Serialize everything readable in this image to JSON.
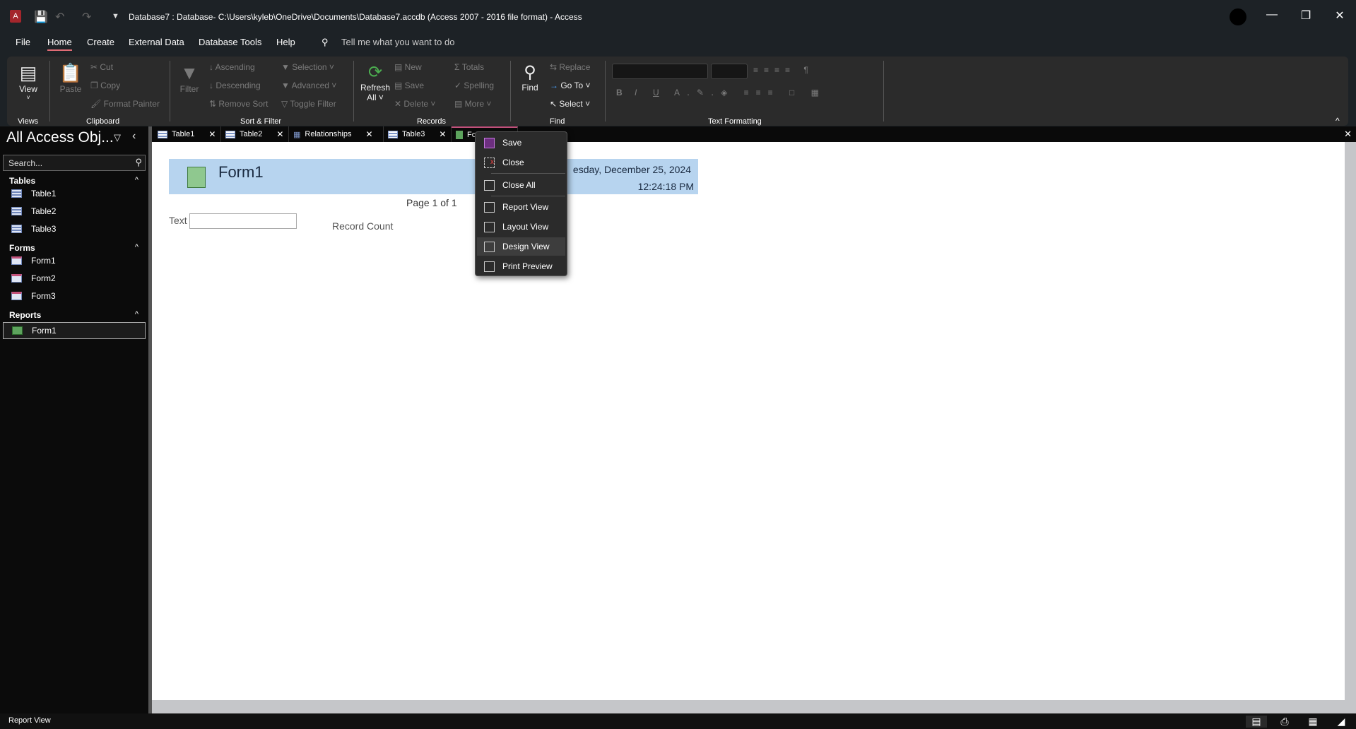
{
  "titlebar": {
    "title": "Database7 : Database- C:\\Users\\kyleb\\OneDrive\\Documents\\Database7.accdb (Access 2007 - 2016 file format)  -  Access"
  },
  "menu": {
    "items": [
      "File",
      "Home",
      "Create",
      "External Data",
      "Database Tools",
      "Help"
    ],
    "tell_me": "Tell me what you want to do"
  },
  "ribbon": {
    "views": {
      "view": "View",
      "group": "Views"
    },
    "clipboard": {
      "paste": "Paste",
      "cut": "Cut",
      "copy": "Copy",
      "format_painter": "Format Painter",
      "group": "Clipboard"
    },
    "sort_filter": {
      "filter": "Filter",
      "ascending": "Ascending",
      "descending": "Descending",
      "remove_sort": "Remove Sort",
      "selection": "Selection",
      "advanced": "Advanced",
      "toggle_filter": "Toggle Filter",
      "group": "Sort & Filter"
    },
    "records": {
      "refresh": "Refresh",
      "all": "All",
      "new": "New",
      "save": "Save",
      "delete": "Delete",
      "totals": "Totals",
      "spelling": "Spelling",
      "more": "More",
      "group": "Records"
    },
    "find": {
      "find": "Find",
      "replace": "Replace",
      "goto": "Go To",
      "select": "Select",
      "group": "Find"
    },
    "text_formatting": {
      "group": "Text Formatting",
      "bold": "B",
      "italic": "I",
      "underline": "U"
    }
  },
  "tabs": [
    {
      "label": "Table1"
    },
    {
      "label": "Table2"
    },
    {
      "label": "Relationships"
    },
    {
      "label": "Table3"
    },
    {
      "label": "Fo"
    }
  ],
  "nav": {
    "title": "All Access Obj...",
    "search_placeholder": "Search...",
    "groups": [
      {
        "label": "Tables",
        "items": [
          "Table1",
          "Table2",
          "Table3"
        ]
      },
      {
        "label": "Forms",
        "items": [
          "Form1",
          "Form2",
          "Form3"
        ]
      },
      {
        "label": "Reports",
        "items": [
          "Form1"
        ]
      }
    ]
  },
  "report": {
    "title": "Form1",
    "date": "esday, December 25, 2024",
    "time": "12:24:18 PM",
    "page": "Page 1 of 1",
    "text_label": "Text",
    "record_count": "Record Count"
  },
  "context_menu": {
    "items": [
      "Save",
      "Close",
      "Close All",
      "Report View",
      "Layout View",
      "Design View",
      "Print Preview"
    ]
  },
  "status": {
    "text": "Report View"
  }
}
